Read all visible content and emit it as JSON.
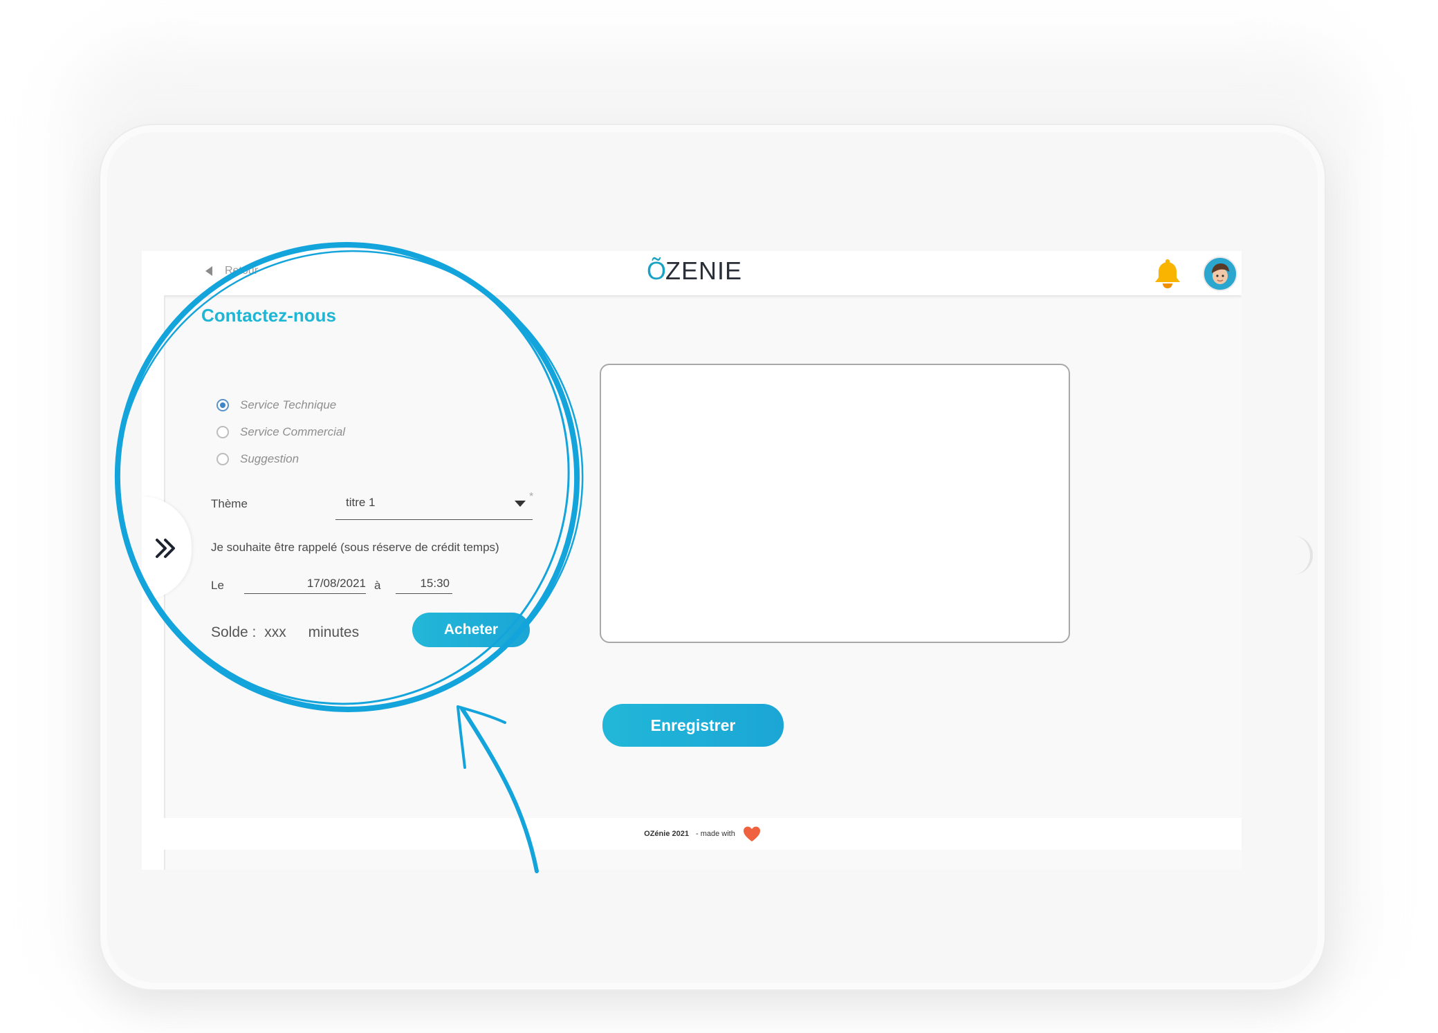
{
  "header": {
    "back_label": "Retour",
    "logo_text": "ZENIE",
    "logo_accent": "Õ",
    "bell_icon": "bell-icon",
    "avatar_icon": "user-avatar"
  },
  "page": {
    "title": "Contactez-nous"
  },
  "form": {
    "service_options": [
      {
        "label": "Service Technique",
        "checked": true
      },
      {
        "label": "Service Commercial",
        "checked": false
      },
      {
        "label": "Suggestion",
        "checked": false
      }
    ],
    "theme_label": "Thème",
    "theme_value": "titre 1",
    "required_mark": "*",
    "callback_label": "Je souhaite être rappelé (sous réserve de crédit temps)",
    "date_label": "Le",
    "date_value": "17/08/2021",
    "time_connector": "à",
    "time_value": "15:30",
    "balance_label": "Solde :",
    "balance_value": "xxx",
    "balance_unit": "minutes",
    "buy_button": "Acheter",
    "save_button": "Enregistrer"
  },
  "footer": {
    "brand": "OZénie 2021",
    "made_with": "- made with"
  },
  "colors": {
    "accent": "#1fb6d5",
    "button": "#1ba6d6",
    "bell": "#f8b400",
    "heart": "#f0623f",
    "annotation": "#14a4dc"
  }
}
